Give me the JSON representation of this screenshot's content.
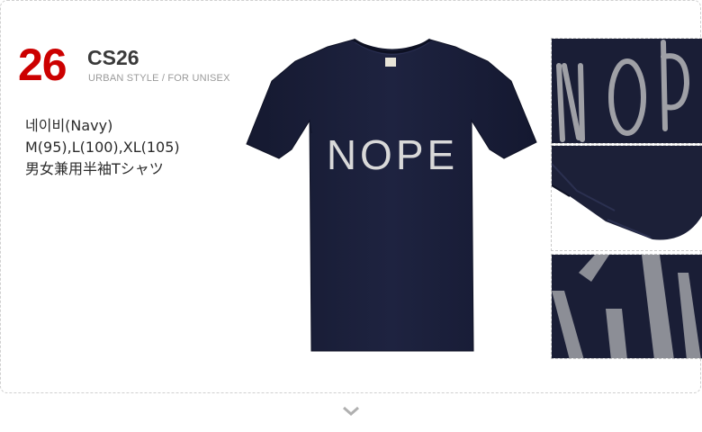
{
  "product": {
    "number": "26",
    "number_color": "#cc0000",
    "code": "CS26",
    "subtitle": "URBAN STYLE / FOR UNISEX",
    "color_label": "네이비(Navy)",
    "sizes": "M(95),L(100),XL(105)",
    "description_jp": "男女兼用半袖Tシャツ",
    "shirt_print": "NOPE",
    "shirt_color": "#1b1f38"
  },
  "images": {
    "main": "navy-tshirt-front-image",
    "details": [
      "print-closeup-image",
      "sleeve-hem-closeup-image",
      "print-texture-closeup-image"
    ]
  },
  "icons": {
    "more": "chevron-down-icon"
  }
}
